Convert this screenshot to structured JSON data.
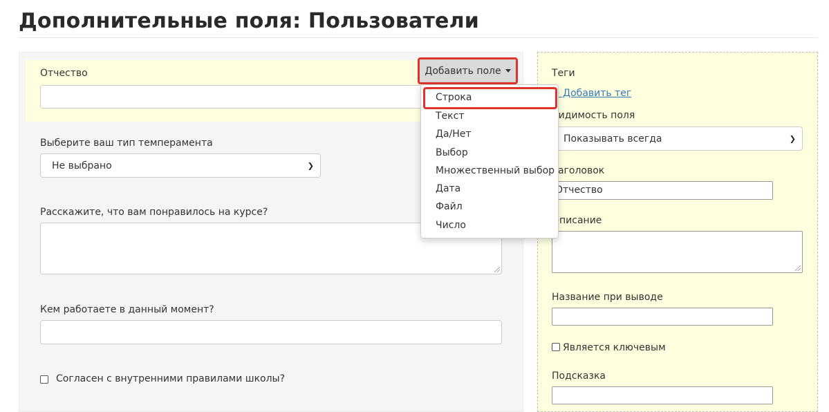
{
  "page": {
    "title": "Дополнительные поля: Пользователи"
  },
  "toolbar": {
    "add_field_label": "Добавить поле"
  },
  "form": {
    "patronymic_label": "Отчество",
    "temperament_label": "Выберите ваш тип темперамента",
    "temperament_value": "Не выбрано",
    "course_label": "Расскажите, что вам понравилось на курсе?",
    "job_label": "Кем работаете в данный момент?",
    "rules_label": "Согласен с внутренними правилами школы?"
  },
  "dropdown": {
    "items": [
      "Строка",
      "Текст",
      "Да/Нет",
      "Выбор",
      "Множественный выбор",
      "Дата",
      "Файл",
      "Число"
    ],
    "selected": "Строка"
  },
  "settings": {
    "tags_label": "Теги",
    "add_tag_link": "+ Добавить тег",
    "visibility_label": "Видимость поля",
    "visibility_value": "Показывать всегда",
    "header_label": "Заголовок",
    "header_value": "Отчество",
    "description_label": "Описание",
    "output_name_label": "Название при выводе",
    "key_label": "Является ключевым",
    "hint_label": "Подсказка"
  }
}
